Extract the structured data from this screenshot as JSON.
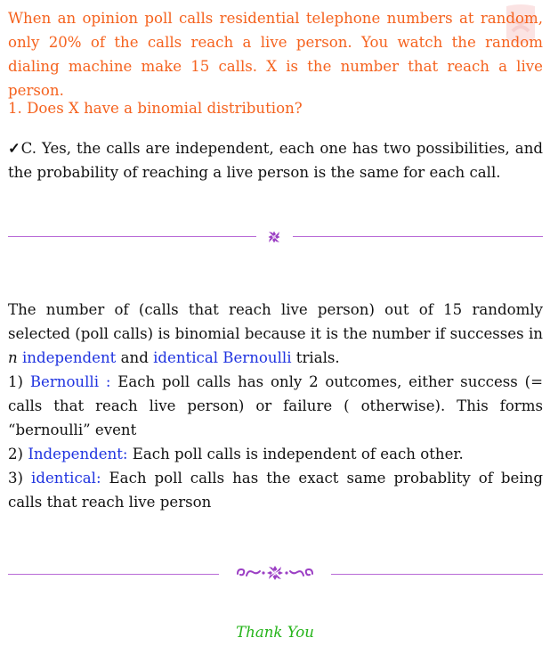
{
  "question": {
    "text": "When an opinion poll calls residential telephone numbers at random, only 20% of the calls reach a live person. You watch the random dialing machine make 15 calls. X is the number that reach a live person.",
    "sub": "1. Does X have a binomial distribution?"
  },
  "answer": {
    "check_mark": "✓",
    "text": "C. Yes, the calls are independent, each one has two possibilities, and the probability of reaching a live person is the same for each call."
  },
  "explanation": {
    "intro_a": "The number of (calls that reach live person) out of 15 randomly selected (poll calls) is binomial because it is the number if successes in ",
    "intro_n": "n",
    "intro_b": " ",
    "intro_independent": "independent",
    "intro_c": " and ",
    "intro_identical_bernoulli": "identical Bernoulli",
    "intro_d": " trials.",
    "item1_num": "1) ",
    "item1_key": "Bernoulli :",
    "item1_text": " Each poll calls has only 2 outcomes, either success (= calls that reach live person) or failure ( otherwise).  This forms “bernoulli” event",
    "item2_num": "2) ",
    "item2_key": "Independent:",
    "item2_text": " Each poll calls is independent of each other.",
    "item3_num": "3) ",
    "item3_key": "identical:",
    "item3_text": " Each poll calls has the exact same probablity of being calls that reach live person"
  },
  "footer": {
    "thanks": "Thank You"
  },
  "colors": {
    "question": "#f5621e",
    "keyword": "#1f33e0",
    "rule": "#b86ad6",
    "thanks": "#25b41a"
  },
  "icons": {
    "watermark": "logo-watermark-icon",
    "divider_1": "floral-ornament-icon",
    "divider_2": "floral-flourish-ornament-icon"
  }
}
